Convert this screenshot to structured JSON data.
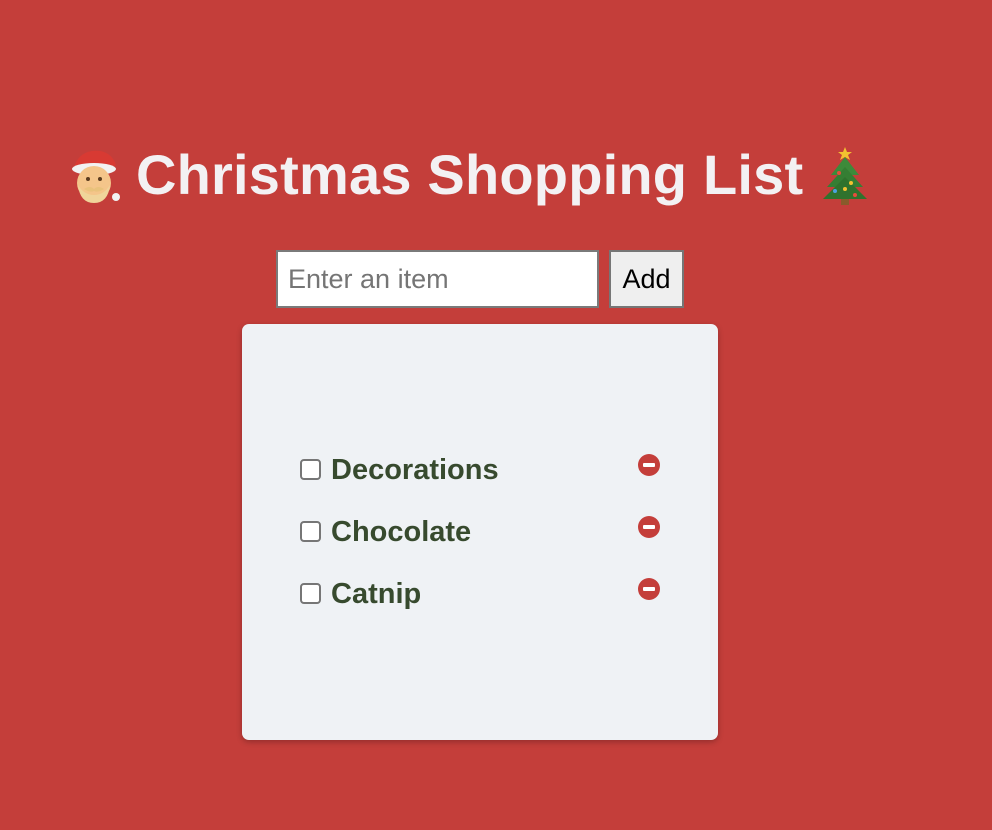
{
  "header": {
    "title": "Christmas Shopping List",
    "leading_icon": "santa-emoji",
    "trailing_icon": "christmas-tree-emoji"
  },
  "add_form": {
    "placeholder": "Enter an item",
    "value": "",
    "button_label": "Add"
  },
  "items": [
    {
      "label": "Decorations",
      "checked": false
    },
    {
      "label": "Chocolate",
      "checked": false
    },
    {
      "label": "Catnip",
      "checked": false
    }
  ],
  "colors": {
    "background": "#c43e3a",
    "title": "#f3f1f3",
    "card": "#eff2f5",
    "item_text": "#374a2e",
    "remove_icon": "#c43e3a"
  }
}
